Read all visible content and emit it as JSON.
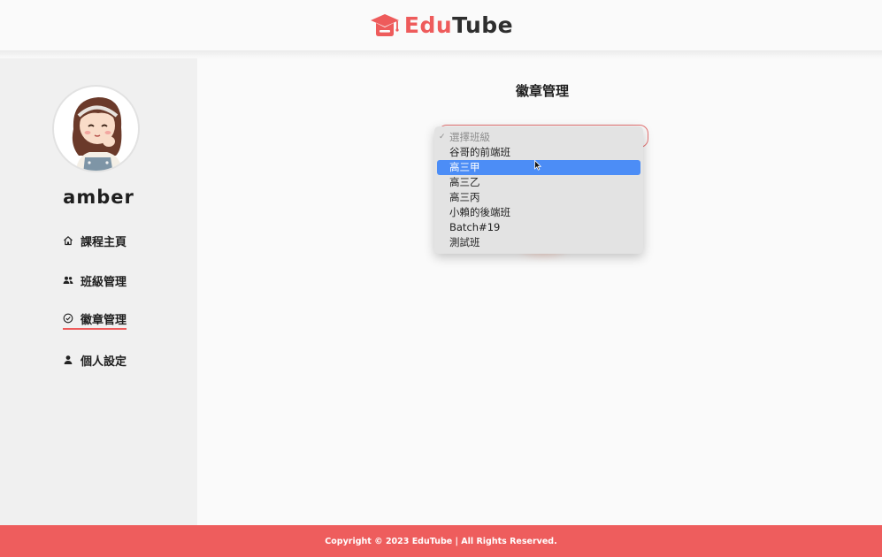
{
  "brand": {
    "icon": "graduation-cap-icon",
    "name_part1": "Edu",
    "name_part2": "Tube",
    "primary_color": "#ee5b5b",
    "dark_color": "#2e2e2e"
  },
  "sidebar": {
    "avatar": "avatar-girl-illustration",
    "username": "amber",
    "items": [
      {
        "label": "課程主頁",
        "icon": "home-icon",
        "active": false
      },
      {
        "label": "班級管理",
        "icon": "users-icon",
        "active": false
      },
      {
        "label": "徽章管理",
        "icon": "badge-check-icon",
        "active": true
      },
      {
        "label": "個人設定",
        "icon": "user-icon",
        "active": false
      }
    ]
  },
  "main": {
    "title": "徽章管理",
    "class_select": {
      "placeholder": "選擇班級",
      "selected": "高三甲",
      "options": [
        "谷哥的前端班",
        "高三甲",
        "高三乙",
        "高三丙",
        "小賴的後端班",
        "Batch#19",
        "測試班"
      ]
    }
  },
  "footer": {
    "copyright": "Copyright © 2023 EduTube | All Rights Reserved."
  },
  "colors": {
    "accent": "#ee5b5b",
    "selection": "#4c8df6",
    "footer_bg": "#ee5d5d"
  }
}
